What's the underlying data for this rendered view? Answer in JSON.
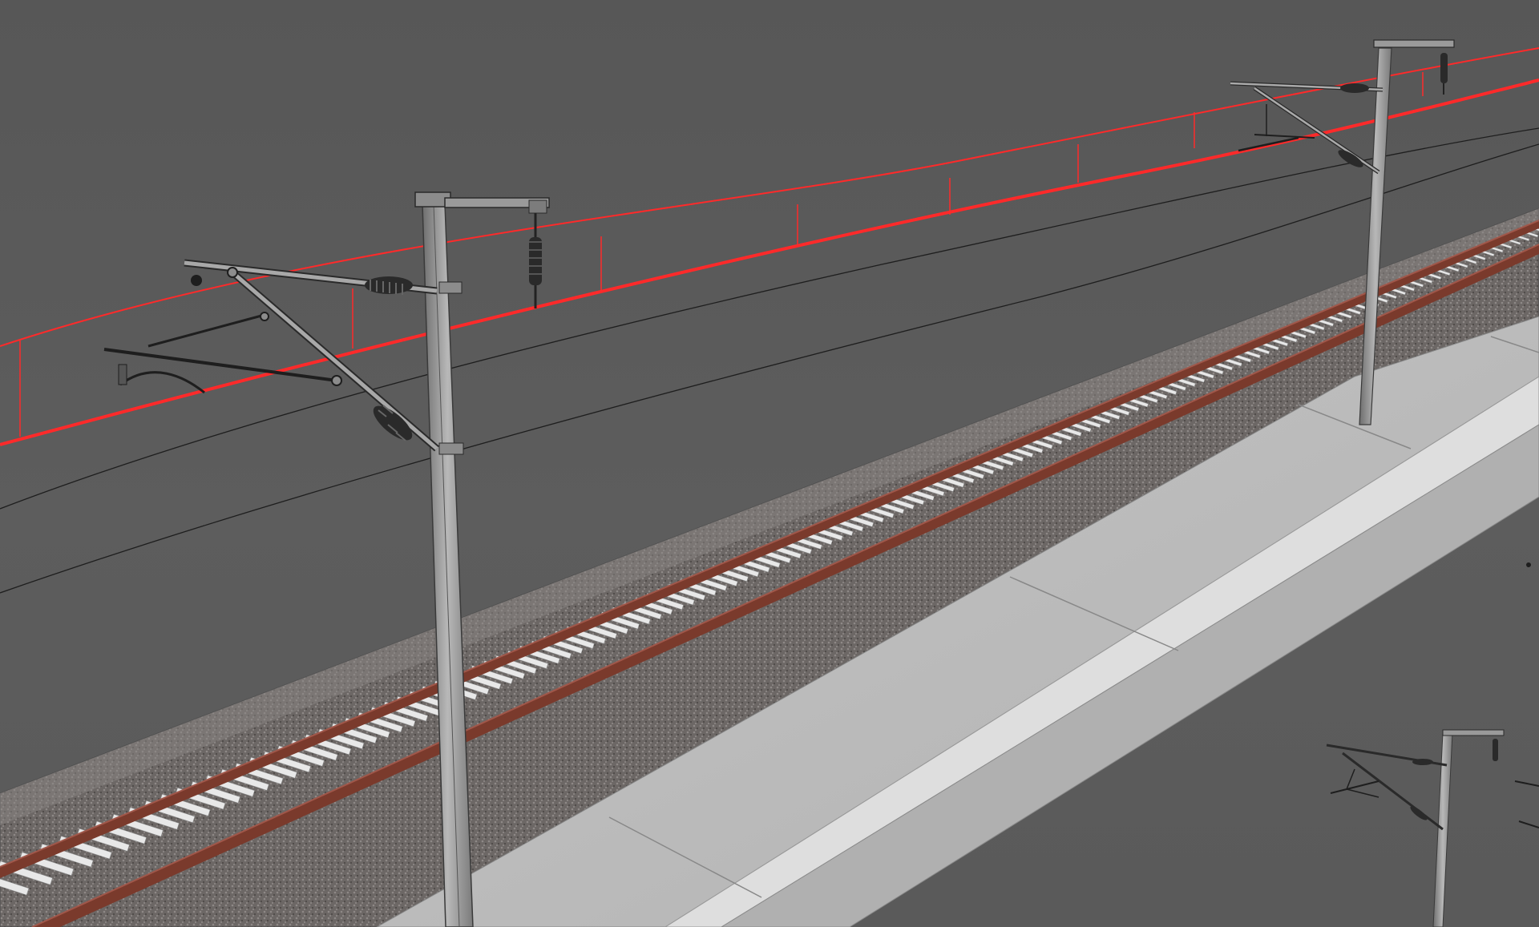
{
  "scene": {
    "background_color": "#5a5a5a",
    "rail_color": "#7a3a2c",
    "rail_highlight_color": "#a0574a",
    "sleeper_color": "#e8e8e8",
    "ballast_color": "#6e6a68",
    "platform_top_color": "#bdbdbd",
    "platform_edge_color": "#dcdcdc",
    "catenary_highlight_color": "#ff2a2a",
    "mast_color": "#9a9a9a",
    "insulator_color": "#2a2a2a",
    "wire_color": "#1e1e1e"
  },
  "objects": [
    {
      "name": "railway-track",
      "label": ""
    },
    {
      "name": "ballast-bed",
      "label": ""
    },
    {
      "name": "station-platform",
      "label": ""
    },
    {
      "name": "overhead-catenary-mast-near",
      "label": ""
    },
    {
      "name": "overhead-catenary-mast-far",
      "label": ""
    },
    {
      "name": "overhead-catenary-mast-distant",
      "label": ""
    },
    {
      "name": "contact-wire-selected",
      "label": ""
    }
  ]
}
